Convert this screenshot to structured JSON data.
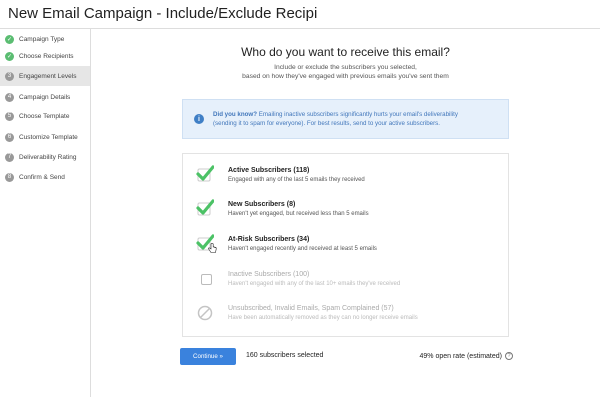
{
  "header": {
    "title": "New Email Campaign - Include/Exclude Recipi"
  },
  "sidebar": {
    "steps": [
      {
        "label": "Campaign Type",
        "marker": "✓",
        "state": "done"
      },
      {
        "label": "Choose Recipients",
        "marker": "✓",
        "state": "done"
      },
      {
        "label": "Engagement Levels",
        "marker": "3",
        "state": "active"
      },
      {
        "label": "Campaign Details",
        "marker": "4",
        "state": "pending"
      },
      {
        "label": "Choose Template",
        "marker": "5",
        "state": "pending"
      },
      {
        "label": "Customize Template",
        "marker": "6",
        "state": "pending"
      },
      {
        "label": "Deliverability Rating",
        "marker": "7",
        "state": "pending"
      },
      {
        "label": "Confirm & Send",
        "marker": "8",
        "state": "pending"
      }
    ]
  },
  "main": {
    "title": "Who do you want to receive this email?",
    "subtitle_line1": "Include or exclude the subscribers you selected,",
    "subtitle_line2": "based on how they've engaged with previous emails you've sent them",
    "tip": {
      "icon": "i",
      "lead": "Did you know?",
      "text_line1": " Emailing inactive subscribers significantly hurts your email's deliverability",
      "text_line2": "(sending it to spam for everyone). For best results, send to your active subscribers."
    },
    "options": [
      {
        "title": "Active Subscribers (118)",
        "desc": "Engaged with any of the last 5 emails they received",
        "checked": true
      },
      {
        "title": "New Subscribers (8)",
        "desc": "Haven't yet engaged, but received less than 5 emails",
        "checked": true
      },
      {
        "title": "At-Risk Subscribers (34)",
        "desc": "Haven't engaged recently and received at least 5 emails",
        "checked": true
      },
      {
        "title": "Inactive Subscribers (100)",
        "desc": "Haven't engaged with any of the last 10+ emails they've received",
        "checked": false
      },
      {
        "title": "Unsubscribed, Invalid Emails, Spam Complained (57)",
        "desc": "Have been automatically removed as they can no longer receive emails",
        "checked": false
      }
    ],
    "footer": {
      "continue_label": "Continue »",
      "selected_text": "160 subscribers selected",
      "open_rate_text": "49% open rate (estimated)",
      "help_icon": "?"
    }
  },
  "colors": {
    "accent": "#3a82dd",
    "check": "#4cc266",
    "done": "#5bbd72",
    "tip_bg": "#e6f0fb"
  }
}
